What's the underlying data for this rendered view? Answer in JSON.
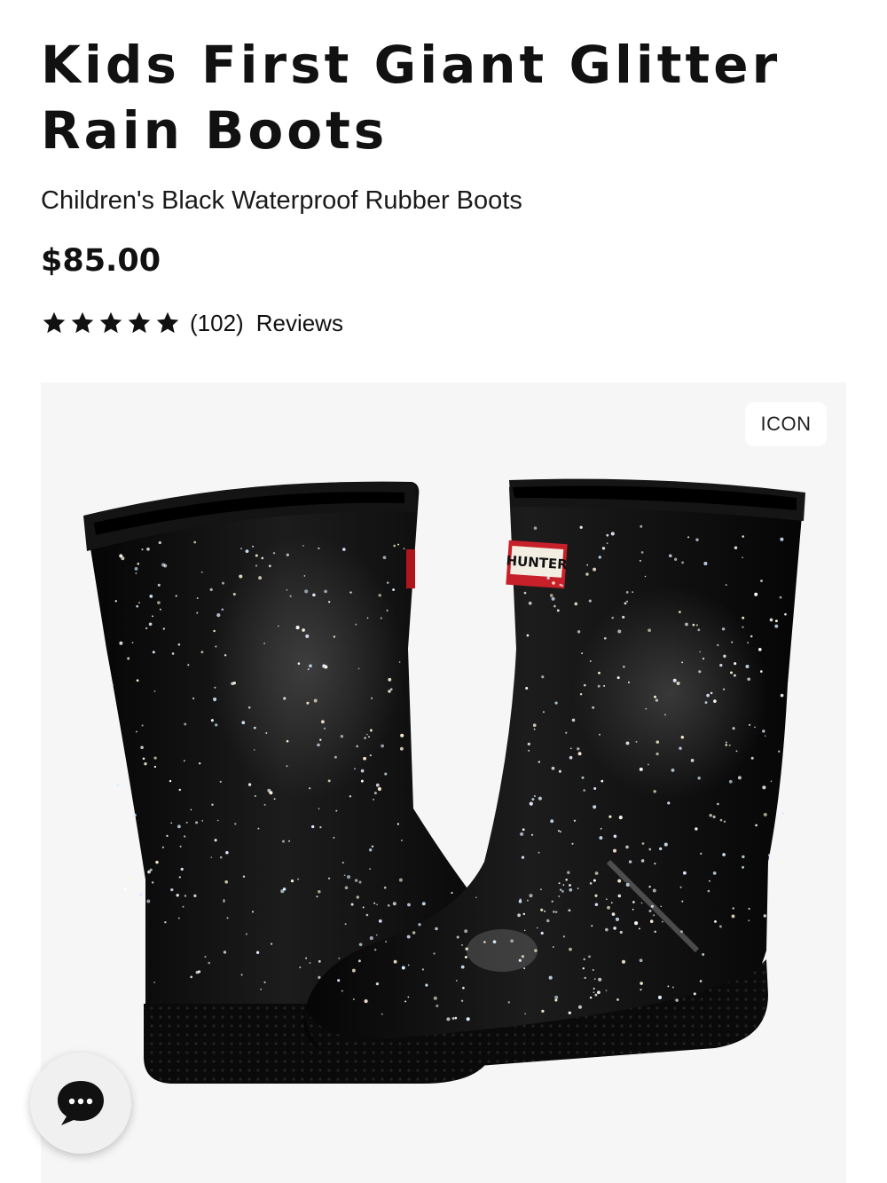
{
  "product": {
    "title": "Kids First Giant Glitter Rain Boots",
    "subtitle": "Children's Black Waterproof Rubber Boots",
    "price": "$85.00",
    "rating": {
      "stars": 5,
      "count_label": "(102)",
      "reviews_label": "Reviews"
    }
  },
  "gallery": {
    "badge": "ICON",
    "brand_tag": "HUNTER",
    "image_name": "boots-image"
  },
  "chat": {
    "icon": "chat-bubble-icon"
  },
  "colors": {
    "text": "#111111",
    "gallery_bg": "#f6f6f6",
    "boot": "#0b0b0b",
    "tag_red": "#c8202a"
  }
}
